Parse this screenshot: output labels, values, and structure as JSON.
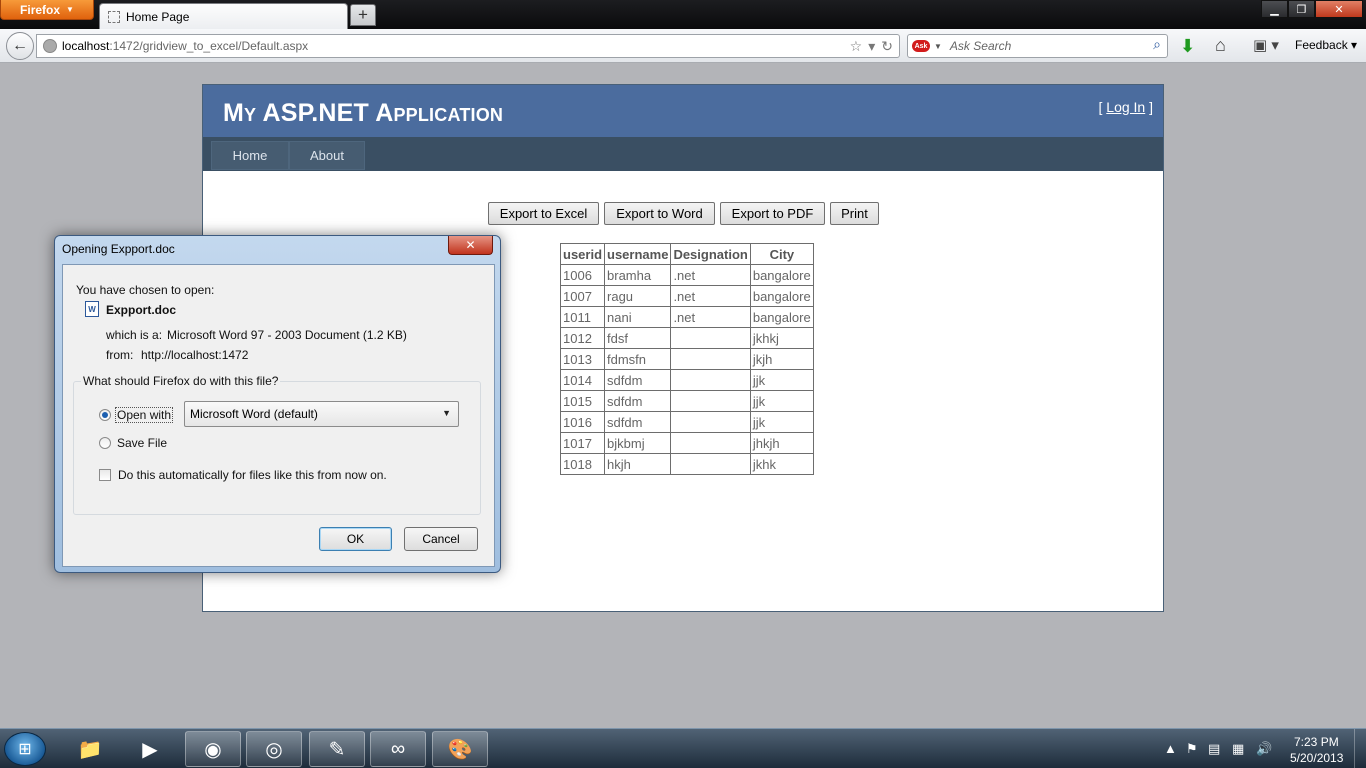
{
  "browser": {
    "menu_button": "Firefox",
    "tab_title": "Home Page",
    "new_tab": "+",
    "url_host": "localhost",
    "url_rest": ":1472/gridview_to_excel/Default.aspx",
    "search_logo": "Ask",
    "search_placeholder": "Ask Search",
    "feedback": "Feedback",
    "icons": [
      "back-icon",
      "star-icon",
      "reload-icon",
      "search-icon",
      "download-icon",
      "home-icon",
      "bookmark-icon",
      "minimize-icon",
      "maximize-icon",
      "close-icon"
    ]
  },
  "page": {
    "app_title": "My ASP.NET Application",
    "login_prefix": "[ ",
    "login_link": "Log In",
    "login_suffix": " ]",
    "menu": [
      "Home",
      "About"
    ],
    "buttons": {
      "excel": "Export to Excel",
      "word": "Export to Word",
      "pdf": "Export to PDF",
      "print": "Print"
    },
    "grid": {
      "headers": [
        "userid",
        "username",
        "Designation",
        "City"
      ],
      "rows": [
        [
          "1006",
          "bramha",
          ".net",
          "bangalore"
        ],
        [
          "1007",
          "ragu",
          ".net",
          "bangalore"
        ],
        [
          "1011",
          "nani",
          ".net",
          "bangalore"
        ],
        [
          "1012",
          "fdsf",
          "",
          "jkhkj"
        ],
        [
          "1013",
          "fdmsfn",
          "",
          "jkjh"
        ],
        [
          "1014",
          "sdfdm",
          "",
          "jjk"
        ],
        [
          "1015",
          "sdfdm",
          "",
          "jjk"
        ],
        [
          "1016",
          "sdfdm",
          "",
          "jjk"
        ],
        [
          "1017",
          "bjkbmj",
          "",
          "jhkjh"
        ],
        [
          "1018",
          "hkjh",
          "",
          "jkhk"
        ]
      ]
    },
    "colors": {
      "header": "#4b6c9e",
      "menu_bar": "#3a4f63",
      "menu_item": "#465c71"
    }
  },
  "dialog": {
    "title": "Opening Expport.doc",
    "chosen_label": "You have chosen to open:",
    "file_icon": "W",
    "file_name": "Expport.doc",
    "type_label": "which is a:",
    "type_value": "Microsoft Word 97 - 2003 Document (1.2 KB)",
    "from_label": "from:",
    "from_value": "http://localhost:1472",
    "question": "What should Firefox do with this file?",
    "open_with_label": "Open with",
    "open_with_value": "Microsoft Word (default)",
    "save_file_label": "Save File",
    "auto_label": "Do this automatically for files like this from now on.",
    "ok": "OK",
    "cancel": "Cancel"
  },
  "taskbar": {
    "apps": [
      "explorer-icon",
      "media-player-icon",
      "firefox-icon",
      "chrome-icon",
      "vs-tools-icon",
      "visual-studio-icon",
      "paint-icon"
    ],
    "time": "7:23 PM",
    "date": "5/20/2013"
  }
}
